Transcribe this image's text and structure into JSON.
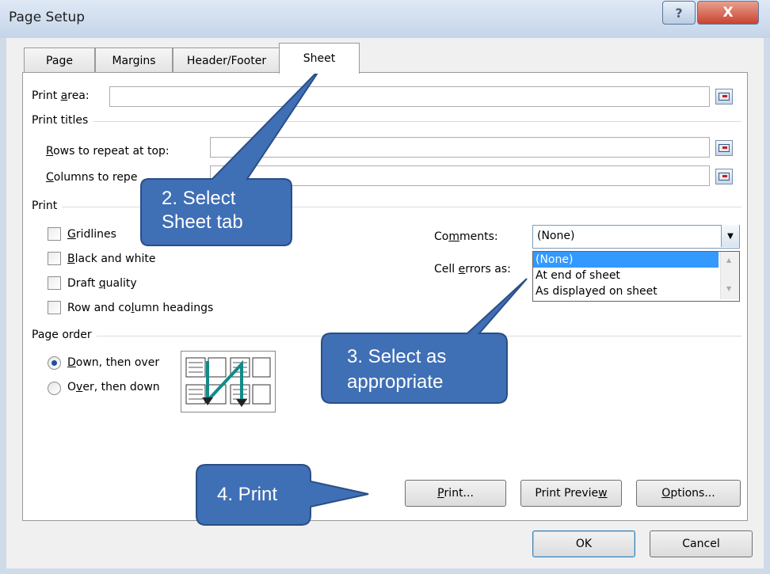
{
  "window": {
    "title": "Page Setup",
    "help_glyph": "?",
    "close_glyph": "X"
  },
  "tabs": [
    {
      "label": "Page"
    },
    {
      "label": "Margins"
    },
    {
      "label": "Header/Footer"
    },
    {
      "label": "Sheet",
      "active": true
    }
  ],
  "sheet": {
    "print_area_label": "Print area:",
    "print_area_value": "",
    "print_titles_label": "Print titles",
    "rows_repeat_label": "Rows to repeat at top:",
    "rows_repeat_value": "",
    "cols_repeat_label": "Columns to repe",
    "cols_repeat_value": "",
    "print_group_label": "Print",
    "checkboxes": [
      {
        "label": "Gridlines",
        "checked": false
      },
      {
        "label": "Black and white",
        "checked": false
      },
      {
        "label": "Draft quality",
        "checked": false
      },
      {
        "label": "Row and column headings",
        "checked": false
      }
    ],
    "comments_label": "Comments:",
    "comments_value": "(None)",
    "cell_errors_label": "Cell errors as:",
    "comments_options": [
      "(None)",
      "At end of sheet",
      "As displayed on sheet"
    ],
    "page_order_label": "Page order",
    "page_order_options": [
      {
        "label": "Down, then over",
        "selected": true
      },
      {
        "label": "Over, then down",
        "selected": false
      }
    ]
  },
  "buttons": {
    "print": "Print...",
    "print_preview": "Print Preview",
    "options": "Options...",
    "ok": "OK",
    "cancel": "Cancel"
  },
  "callouts": {
    "step2_line1": "2.  Select",
    "step2_line2": "Sheet tab",
    "step3_line1": "3. Select as",
    "step3_line2": "appropriate",
    "step4": "4. Print"
  },
  "colors": {
    "callout_fill": "#3f6fb5",
    "callout_border": "#2b4e85",
    "selection": "#3399ff",
    "close_button": "#c9432f"
  }
}
